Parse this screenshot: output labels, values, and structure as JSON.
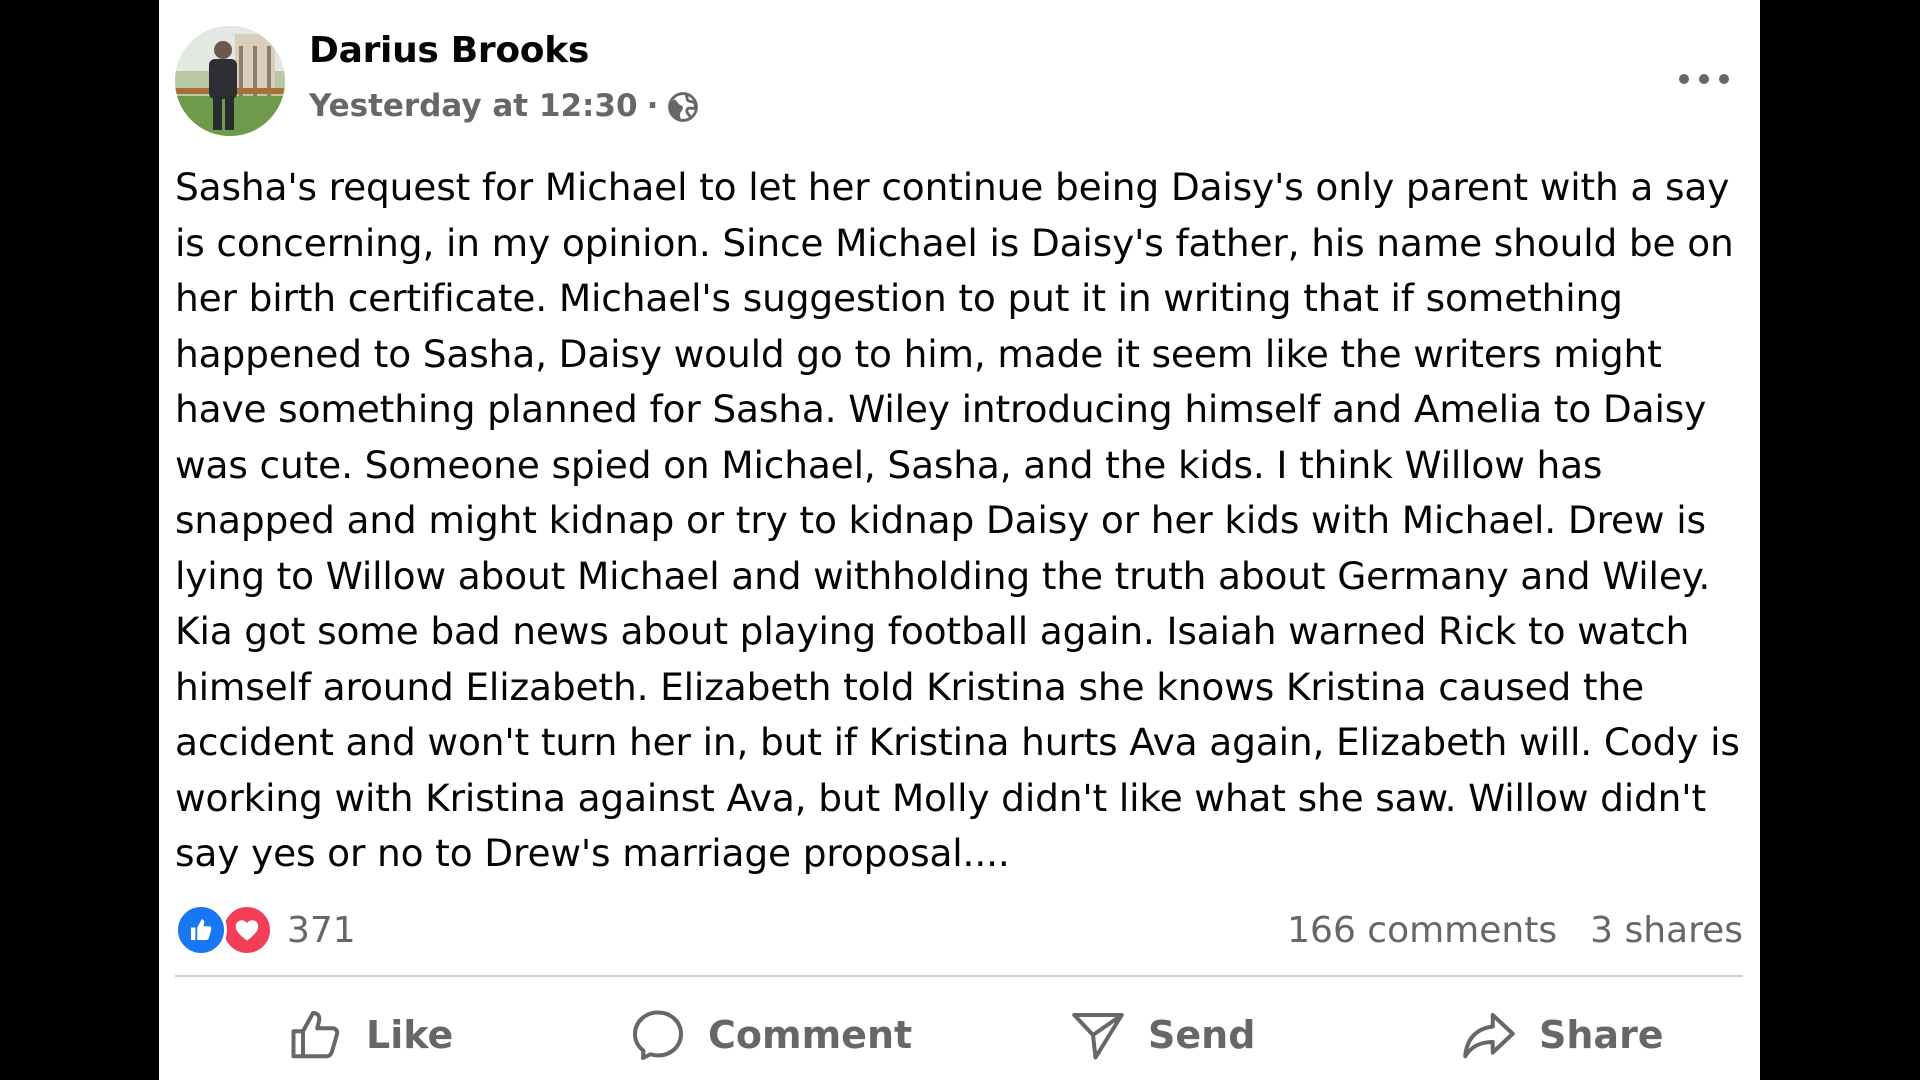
{
  "post": {
    "author": "Darius Brooks",
    "timestamp": "Yesterday at 12:30",
    "separator": "·",
    "privacy_icon": "globe-icon",
    "body": "Sasha's request for Michael to let her continue being Daisy's only parent with a say is concerning, in my opinion. Since Michael is Daisy's father, his name should be on her birth certificate. Michael's suggestion to put it in writing that if something happened to Sasha, Daisy would go to him, made it seem like the writers might have something planned for Sasha. Wiley introducing himself and Amelia to Daisy was cute. Someone spied on Michael, Sasha, and the kids. I think Willow has snapped and might kidnap or try to kidnap Daisy or her kids with Michael. Drew is lying to Willow about Michael and withholding the truth about Germany and Wiley. Kia got some bad news about playing football again. Isaiah warned Rick to watch himself around Elizabeth. Elizabeth told Kristina she knows Kristina caused the accident and won't turn her in, but if Kristina hurts Ava again, Elizabeth will. Cody is working with Kristina against Ava, but Molly didn't like what she saw. Willow didn't say yes or no to Drew's marriage proposal...."
  },
  "stats": {
    "reaction_count": "371",
    "reactions": [
      "like",
      "love"
    ],
    "comments": "166 comments",
    "shares": "3 shares"
  },
  "actions": {
    "like": "Like",
    "comment": "Comment",
    "send": "Send",
    "share": "Share"
  },
  "colors": {
    "like_blue": "#1877f2",
    "love_red": "#f33e58",
    "secondary_text": "#65676b",
    "primary_text": "#050505"
  }
}
